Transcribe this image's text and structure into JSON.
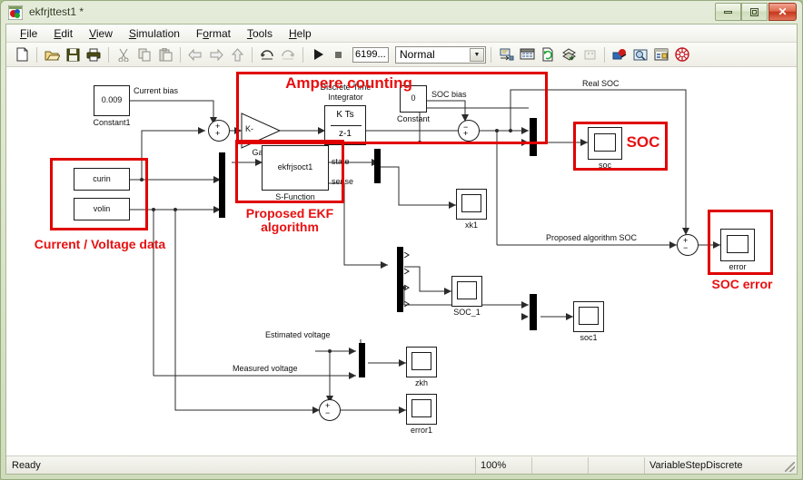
{
  "window": {
    "title": "ekfrjttest1 *",
    "icon": "simulink-model-icon",
    "minimize_label": "Minimize",
    "maximize_label": "Maximize",
    "close_label": "Close"
  },
  "menubar": {
    "items": [
      {
        "label": "File",
        "mnemonic": "F"
      },
      {
        "label": "Edit",
        "mnemonic": "E"
      },
      {
        "label": "View",
        "mnemonic": "V"
      },
      {
        "label": "Simulation",
        "mnemonic": "S"
      },
      {
        "label": "Format",
        "mnemonic": "o"
      },
      {
        "label": "Tools",
        "mnemonic": "T"
      },
      {
        "label": "Help",
        "mnemonic": "H"
      }
    ]
  },
  "toolbar": {
    "buttons": [
      {
        "name": "new-model-icon",
        "tip": "New model"
      },
      {
        "name": "open-model-icon",
        "tip": "Open model"
      },
      {
        "name": "save-icon",
        "tip": "Save"
      },
      {
        "name": "print-icon",
        "tip": "Print"
      },
      {
        "name": "cut-icon",
        "tip": "Cut"
      },
      {
        "name": "copy-icon",
        "tip": "Copy"
      },
      {
        "name": "paste-icon",
        "tip": "Paste"
      },
      {
        "name": "back-arrow-icon",
        "tip": "Back"
      },
      {
        "name": "forward-arrow-icon",
        "tip": "Forward"
      },
      {
        "name": "up-arrow-icon",
        "tip": "Go to parent"
      },
      {
        "name": "undo-icon",
        "tip": "Undo"
      },
      {
        "name": "redo-icon",
        "tip": "Redo"
      },
      {
        "name": "start-simulation-icon",
        "tip": "Start simulation"
      },
      {
        "name": "stop-simulation-icon",
        "tip": "Stop simulation"
      },
      {
        "name": "update-diagram-icon",
        "tip": "Update diagram"
      },
      {
        "name": "build-model-icon",
        "tip": "Build model"
      },
      {
        "name": "refresh-icon",
        "tip": "Refresh"
      },
      {
        "name": "library-browser-icon",
        "tip": "Library browser"
      },
      {
        "name": "toggle-scope-icon",
        "tip": "Toggle scope"
      },
      {
        "name": "debug-icon",
        "tip": "Debug"
      },
      {
        "name": "model-explorer-icon",
        "tip": "Model Explorer"
      },
      {
        "name": "model-info-icon",
        "tip": "Model info"
      },
      {
        "name": "help-model-icon",
        "tip": "Help"
      }
    ],
    "sim_time_value": "6199...",
    "sim_mode_value": "Normal"
  },
  "statusbar": {
    "status": "Ready",
    "zoom": "100%",
    "field_x": "",
    "field_y": "",
    "solver": "VariableStepDiscrete"
  },
  "diagram": {
    "blocks": {
      "constant1": {
        "value": "0.009",
        "name": "Constant1"
      },
      "constant": {
        "value": "0",
        "name": "Constant"
      },
      "curin": {
        "value": "curin"
      },
      "volin": {
        "value": "volin"
      },
      "gain": {
        "value": "K-",
        "name": "Gain"
      },
      "integrator": {
        "line1": "K Ts",
        "line2": "z-1",
        "name_line1": "Discrete-Time",
        "name_line2": "Integrator"
      },
      "sfunction": {
        "value": "ekfrjsoct1",
        "port_state": "state",
        "port_sense": "sense",
        "name": "S-Function"
      },
      "scope_soc": {
        "name": "soc"
      },
      "scope_error": {
        "name": "error"
      },
      "scope_xk1": {
        "name": "xk1"
      },
      "scope_soc_1": {
        "name": "SOC_1"
      },
      "scope_soc1": {
        "name": "soc1"
      },
      "scope_zkh": {
        "name": "zkh"
      },
      "scope_error1": {
        "name": "error1"
      }
    },
    "signal_labels": {
      "current_bias": "Current bias",
      "soc_bias": "SOC bias",
      "real_soc": "Real SOC",
      "proposed_algorithm_soc": "Proposed algorithm SOC",
      "estimated_voltage": "Estimated voltage",
      "measured_voltage": "Measured voltage"
    },
    "annotations": [
      {
        "id": "ampere-counting",
        "text": "Ampere counting",
        "color": "#e81010"
      },
      {
        "id": "current-voltage",
        "text": "Current / Voltage data",
        "color": "#e81010"
      },
      {
        "id": "proposed-ekf",
        "text": "Proposed EKF\nalgorithm",
        "color": "#e81010"
      },
      {
        "id": "soc",
        "text": "SOC",
        "color": "#e81010"
      },
      {
        "id": "soc-error",
        "text": "SOC error",
        "color": "#e81010"
      }
    ]
  }
}
